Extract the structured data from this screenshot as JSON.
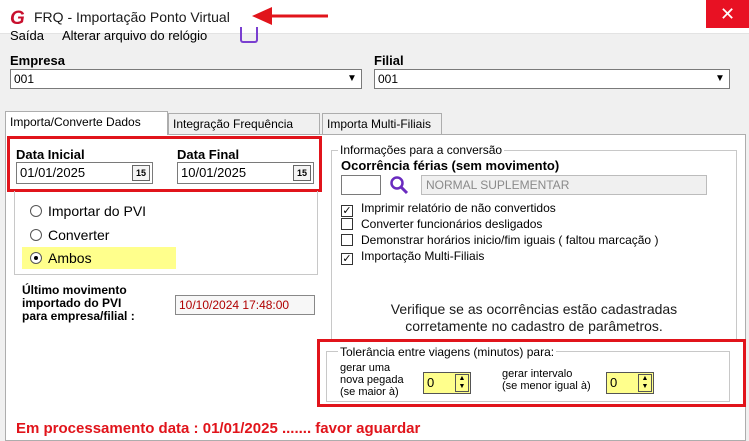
{
  "window": {
    "title": "FRQ - Importação Ponto Virtual",
    "close_glyph": "✕",
    "logo_letter": "G"
  },
  "menu": {
    "exit": "Saída",
    "change_clock_file": "Alterar arquivo do relógio"
  },
  "empresa": {
    "label": "Empresa",
    "value": "001"
  },
  "filial": {
    "label": "Filial",
    "value": "001"
  },
  "tabs": [
    {
      "label": "Importa/Converte Dados",
      "active": true
    },
    {
      "label": "Integração Frequência",
      "active": false
    },
    {
      "label": "Importa Multi-Filiais",
      "active": false
    }
  ],
  "dates": {
    "start_label": "Data Inicial",
    "start_value": "01/01/2025",
    "end_label": "Data Final",
    "end_value": "10/01/2025",
    "calendar_btn": "15"
  },
  "mode_options": [
    {
      "label": "Importar do PVI",
      "selected": false
    },
    {
      "label": "Converter",
      "selected": false
    },
    {
      "label": "Ambos",
      "selected": true
    }
  ],
  "last_import": {
    "label_line1": "Último movimento",
    "label_line2": "importado do PVI",
    "label_line3": "para empresa/filial :",
    "value": "10/10/2024  17:48:00"
  },
  "conversion": {
    "group_title": "Informações para a conversão",
    "occurrence_label": "Ocorrência férias (sem movimento)",
    "occurrence_code": "",
    "occurrence_desc": "NORMAL SUPLEMENTAR",
    "options": [
      {
        "label": "Imprimir relatório de não convertidos",
        "checked": true
      },
      {
        "label": "Converter funcionários desligados",
        "checked": false
      },
      {
        "label": "Demonstrar horários inicio/fim iguais ( faltou marcação )",
        "checked": false
      },
      {
        "label": "Importação Multi-Filiais",
        "checked": true
      }
    ],
    "notice_line1": "Verifique se as ocorrências estão cadastradas",
    "notice_line2": "corretamente  no cadastro de parâmetros."
  },
  "tolerance": {
    "title": "Tolerância entre viagens (minutos) para:",
    "new_punch_line1": "gerar uma",
    "new_punch_line2": "nova pegada",
    "new_punch_line3": "(se maior à)",
    "new_punch_value": "0",
    "interval_line1": "gerar intervalo",
    "interval_line2": "(se menor igual à)",
    "interval_value": "0"
  },
  "status": {
    "message": "Em processamento  data : 01/01/2025 ....... favor aguardar",
    "color": "#e1141b"
  },
  "colors": {
    "highlight_red": "#e1141b",
    "highlight_yellow": "#ffff8c",
    "logo_red": "#c8102e"
  }
}
